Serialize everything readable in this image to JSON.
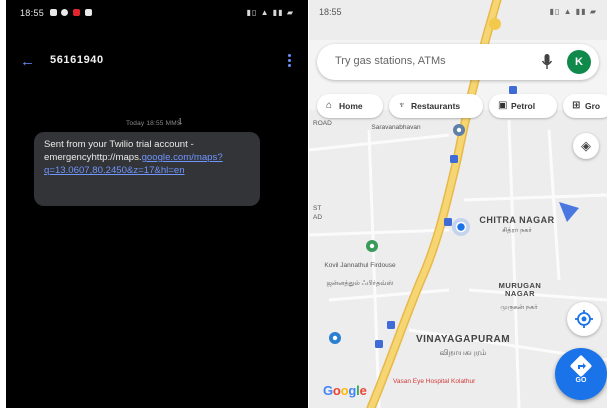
{
  "sms_screen": {
    "status_time": "18:55",
    "contact_number": "56161940",
    "message_date": "Today 18:55 MMS",
    "sim_badge": "1",
    "message": {
      "text_prefix": "Sent from your Twilio trial account - emergencyhttp://maps.",
      "link_text": "google.com/maps?q=13.0607,80.2450&z=17&hl=en",
      "full_text": "Sent from your Twilio trial account - emergencyhttp://maps.google.com/maps?q=13.0607,80.2450&z=17&hl=en"
    }
  },
  "maps_screen": {
    "status_time": "18:55",
    "search_placeholder": "Try gas stations, ATMs",
    "avatar_letter": "K",
    "chips": [
      {
        "label": "Home",
        "icon": "home-icon"
      },
      {
        "label": "Restaurants",
        "icon": "restaurant-icon"
      },
      {
        "label": "Petrol",
        "icon": "fuel-icon"
      },
      {
        "label": "Gro",
        "icon": "cart-icon"
      }
    ],
    "go_label": "GO",
    "map_labels": {
      "chitra_nagar": "CHITRA NAGAR",
      "chitra_nagar_local": "சித்ரா நகர்",
      "murugan_nagar": "MURUGAN NAGAR",
      "murugan_nagar_local": "முருகன் நகர்",
      "vinayagapuram": "VINAYAGAPURAM",
      "vinayagapuram_local": "விநாயகபுரம்",
      "saravanabhavan": "Saravanabhavan",
      "kovil": "Kovil Jannathul Firdouse",
      "kovil_local": "ஜன்னத்துல் ஃபிர்தவ்ஸ்",
      "eye_hospital": "Vasan Eye Hospital Kolathur",
      "left_edge_1": "ST",
      "left_edge_2": "AD",
      "left_edge_3": "ROAD"
    },
    "google_logo": "Google"
  },
  "colors": {
    "sms_background": "#000000",
    "bubble": "#333437",
    "link": "#6f95ff",
    "accent_blue": "#1a73e8",
    "road_yellow": "#f2c94c",
    "map_background": "#ececec"
  }
}
